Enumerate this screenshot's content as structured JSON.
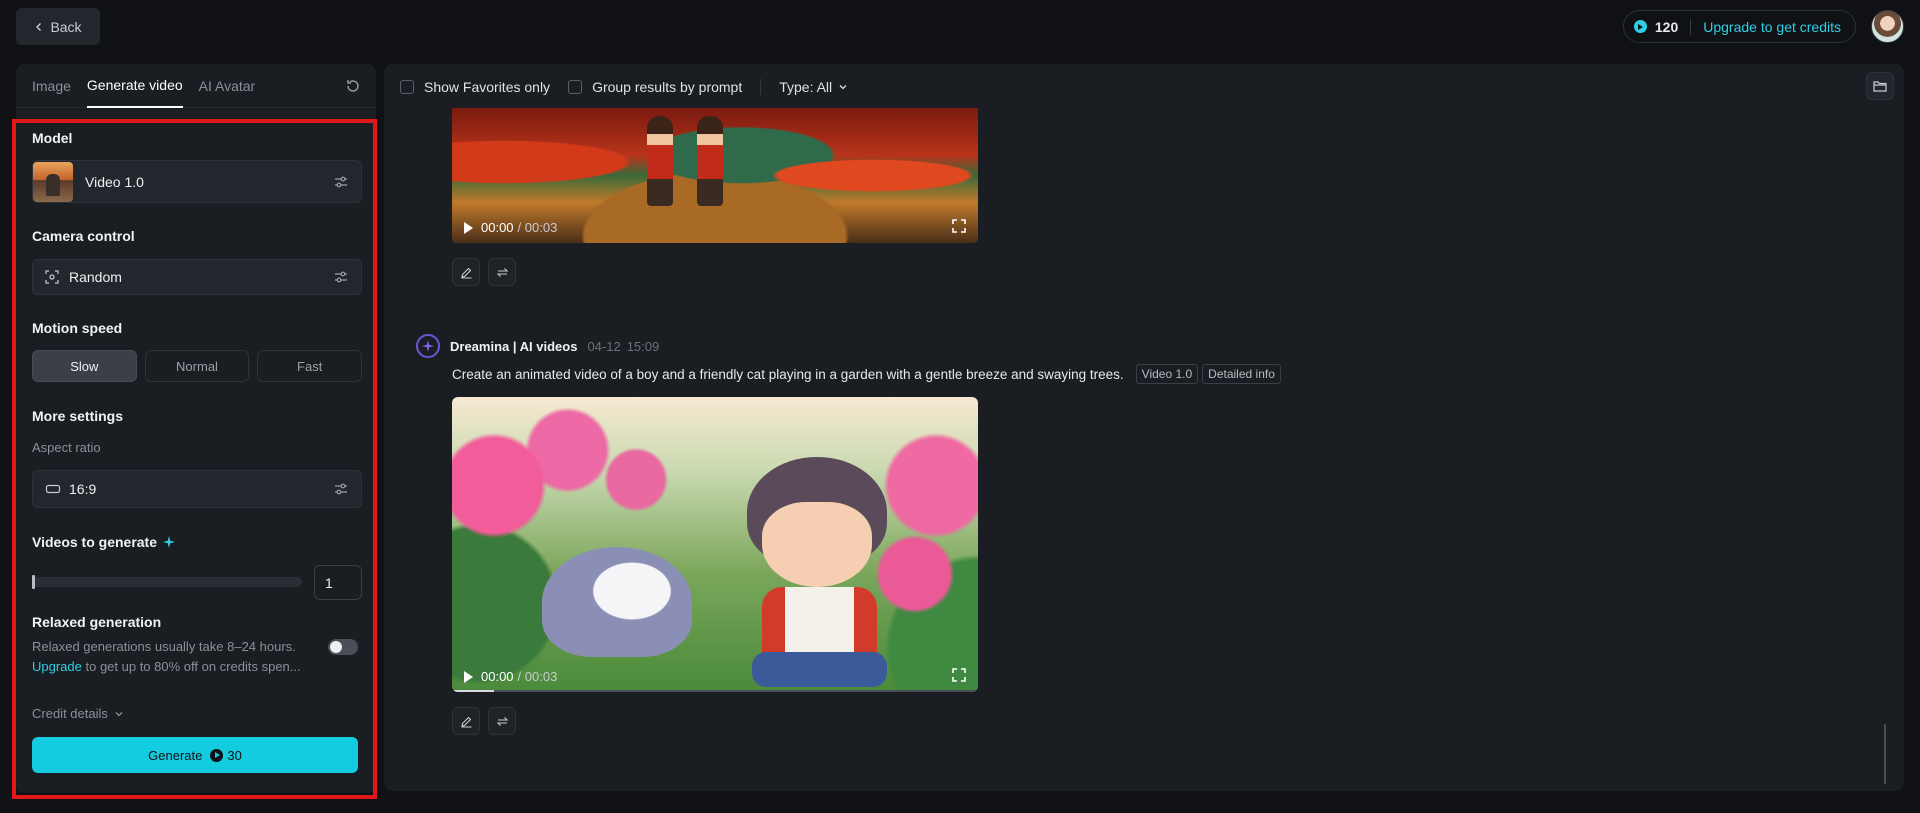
{
  "topbar": {
    "back_label": "Back",
    "credits_count": "120",
    "upgrade_label": "Upgrade to get credits"
  },
  "left_panel": {
    "tabs": [
      {
        "label": "Image"
      },
      {
        "label": "Generate video"
      },
      {
        "label": "AI Avatar"
      }
    ],
    "model": {
      "title": "Model",
      "value": "Video 1.0"
    },
    "camera_control": {
      "title": "Camera control",
      "value": "Random"
    },
    "motion_speed": {
      "title": "Motion speed",
      "options": [
        "Slow",
        "Normal",
        "Fast"
      ],
      "selected": "Slow"
    },
    "more_settings": {
      "title": "More settings",
      "aspect_ratio_label": "Aspect ratio",
      "aspect_ratio_value": "16:9"
    },
    "videos_to_generate": {
      "title": "Videos to generate",
      "value": "1",
      "slider_fraction": 0
    },
    "relaxed_generation": {
      "title": "Relaxed generation",
      "desc_line1": "Relaxed generations usually take 8–24 hours.",
      "link_text": "Upgrade",
      "desc_line2_rest": " to get up to 80% off on credits spen...",
      "enabled": false
    },
    "credit_details_label": "Credit details",
    "generate_label": "Generate",
    "generate_cost": "30"
  },
  "right_panel": {
    "filters": {
      "show_favorites_label": "Show Favorites only",
      "group_results_label": "Group results by prompt",
      "type_label": "Type: All"
    },
    "items": [
      {
        "time_current": "00:00",
        "time_total": "/ 00:03"
      },
      {
        "brand_name": "Dreamina | AI videos",
        "date": "04-12",
        "time": "15:09",
        "prompt": "Create an animated video of a boy and a friendly cat playing in a garden with a gentle breeze and swaying trees.",
        "tags": [
          "Video 1.0",
          "Detailed info"
        ],
        "time_current": "00:00",
        "time_total": "/ 00:03"
      }
    ]
  },
  "colors": {
    "accent": "#13cce0",
    "highlight_border": "#e0181c",
    "background": "#0f1115",
    "panel": "#1a1d22"
  }
}
